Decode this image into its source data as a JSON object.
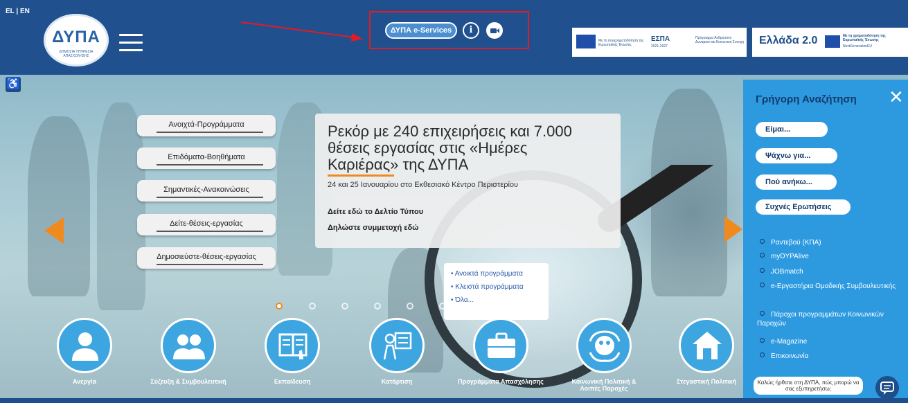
{
  "header": {
    "lang": "EL | EN",
    "logo_text": "ΔΥΠΑ",
    "logo_subtext": "ΔΗΜΟΣΙΑ ΥΠΗΡΕΣΙΑ ΑΠΑΣΧΟΛΗΣΗΣ",
    "eservices_label": "ΔΥΠΑ e-Services",
    "info_icon": "info-icon",
    "video_icon": "video-camera-icon"
  },
  "sponsors": {
    "espa_caption": "Με τη συγχρηματοδότηση της Ευρωπαϊκής Ένωσης",
    "espa_logo": "ΕΣΠΑ",
    "espa_years": "2021-2027",
    "program_text": "Πρόγραμμα Ανθρώπινο Δυναμικό και Κοινωνική Συνοχή",
    "greece2_logo": "Ελλάδα 2.0",
    "greece2_caption": "Με τη χρηματοδότηση της Ευρωπαϊκής Ένωσης",
    "greece2_sub": "NextGenerationEU"
  },
  "left_menu": [
    "Ανοιχτά-Προγράμματα",
    "Επιδόματα-Βοηθήματα",
    "Σημαντικές-Ανακοινώσεις",
    "Δείτε-θέσεις-εργασίας",
    "Δημοσιεύστε-θέσεις-εργασίας"
  ],
  "news": {
    "title": "Ρεκόρ με 240 επιχειρήσεις και 7.000 θέσεις εργασίας στις «Ημέρες Καριέρας» της ΔΥΠΑ",
    "subtitle": "24 και 25 Ιανουαρίου στο Εκθεσιακό Κέντρο Περιστερίου",
    "link1": "Δείτε εδώ το Δελτίο Τύπου",
    "link2": "Δηλώστε συμμετοχή εδώ"
  },
  "dropdown": [
    "• Ανοικτά προγράμματα",
    "• Κλειστά προγράμματα",
    "• Όλα..."
  ],
  "categories": [
    {
      "label": "Ανεργία",
      "icon": "person-icon"
    },
    {
      "label": "Σύζευξη & Συμβουλευτική",
      "icon": "people-icon"
    },
    {
      "label": "Εκπαίδευση",
      "icon": "book-icon"
    },
    {
      "label": "Κατάρτιση",
      "icon": "presentation-icon"
    },
    {
      "label": "Προγράμματα Απασχόλησης",
      "icon": "briefcase-icon"
    },
    {
      "label": "Κοινωνική Πολιτική & Λοιπές Παροχές",
      "icon": "family-hands-icon"
    },
    {
      "label": "Στεγαστική Πολιτική",
      "icon": "house-icon"
    }
  ],
  "quick_search": {
    "title": "Γρήγορη Αναζήτηση",
    "buttons": [
      "Είμαι...",
      "Ψάχνω για...",
      "Πού ανήκω...",
      "Συχνές Ερωτήσεις"
    ],
    "links": [
      "Ραντεβού (ΚΠΑ)",
      "myDYPAlive",
      "JOBmatch",
      "e-Εργαστήρια Ομαδικής Συμβουλευτικής",
      "Πάροχοι προγραμμάτων Κοινωνικών Παροχών",
      "e-Magazine",
      "Επικοινωνία"
    ]
  },
  "chat": {
    "bubble": "Καλώς ήρθατε στη ΔΥΠΑ, πώς μπορώ να σας εξυπηρετήσω;"
  },
  "colors": {
    "header": "#21508f",
    "accent": "#f08a1f",
    "circle": "#3da5e0",
    "panel": "#2d9ae0",
    "highlight": "#e31b23"
  }
}
